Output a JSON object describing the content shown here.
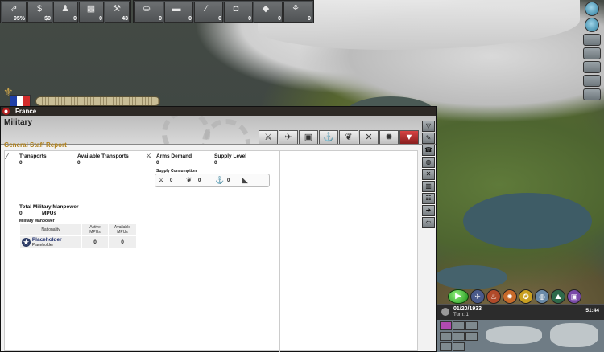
{
  "resources": {
    "items": [
      {
        "icon": "chart-icon",
        "glyph": "⇗",
        "value": "95%"
      },
      {
        "icon": "money-icon",
        "glyph": "$",
        "value": "$0"
      },
      {
        "icon": "manpower-icon",
        "glyph": "♟",
        "value": "0"
      },
      {
        "icon": "supplies-icon",
        "glyph": "▩",
        "value": "0"
      },
      {
        "icon": "industry-icon",
        "glyph": "⚒",
        "value": "43"
      }
    ],
    "goods": [
      {
        "icon": "iron-icon",
        "glyph": "⛀",
        "value": "0"
      },
      {
        "icon": "metal-bar-icon",
        "glyph": "▬",
        "value": "0"
      },
      {
        "icon": "steel-icon",
        "glyph": "∕",
        "value": "0"
      },
      {
        "icon": "rare-material-icon",
        "glyph": "◘",
        "value": "0"
      },
      {
        "icon": "oil-icon",
        "glyph": "◆",
        "value": "0"
      },
      {
        "icon": "food-icon",
        "glyph": "⚘",
        "value": "0"
      }
    ]
  },
  "nation": {
    "name": "France",
    "flag_colors": [
      "#1f3fa8",
      "#ffffff",
      "#d22b2b"
    ]
  },
  "panel": {
    "title": "Military",
    "section": "General Staff Report",
    "tabs": [
      {
        "name": "tab-army",
        "glyph": "⚔"
      },
      {
        "name": "tab-air",
        "glyph": "✈"
      },
      {
        "name": "tab-armor",
        "glyph": "▣"
      },
      {
        "name": "tab-navy",
        "glyph": "⚓"
      },
      {
        "name": "tab-airforce",
        "glyph": "❦"
      },
      {
        "name": "tab-combat",
        "glyph": "✕"
      },
      {
        "name": "tab-battle",
        "glyph": "✹"
      },
      {
        "name": "tab-shield",
        "glyph": "▼"
      }
    ],
    "transports_label": "Transports",
    "transports_value": "0",
    "available_transports_label": "Available Transports",
    "available_transports_value": "0",
    "arms_demand_label": "Arms Demand",
    "arms_demand_value": "0",
    "supply_level_label": "Supply Level",
    "supply_level_value": "0",
    "supply_consumption_label": "Supply Consumption",
    "supply_consumption": [
      {
        "icon": "crossed-swords-icon",
        "glyph": "⚔",
        "value": "0"
      },
      {
        "icon": "wings-icon",
        "glyph": "❦",
        "value": "0"
      },
      {
        "icon": "anchor-icon",
        "glyph": "⚓",
        "value": "0"
      },
      {
        "icon": "boot-icon",
        "glyph": "◣",
        "value": ""
      }
    ],
    "total_manpower_label": "Total Military Manpower",
    "total_manpower_value": "0",
    "total_manpower_unit": "MPUs",
    "military_manpower_label": "Military Manpower",
    "manpower_table": {
      "headers": [
        "Nationality",
        "Active MPUs",
        "Available MPUs"
      ],
      "rows": [
        {
          "name": "Placeholder",
          "sub": "Placeholder",
          "active": "0",
          "available": "0"
        }
      ]
    }
  },
  "time": {
    "date": "01/20/1933",
    "turn": "Turn: 1",
    "clock": "51:44"
  }
}
